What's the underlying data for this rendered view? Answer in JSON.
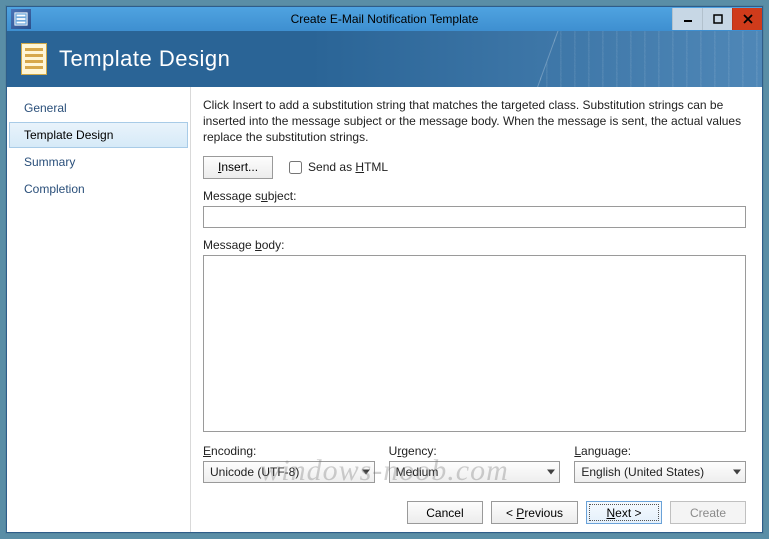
{
  "window": {
    "title": "Create E-Mail Notification Template"
  },
  "banner": {
    "heading": "Template Design"
  },
  "sidebar": {
    "items": [
      {
        "label": "General",
        "active": false
      },
      {
        "label": "Template Design",
        "active": true
      },
      {
        "label": "Summary",
        "active": false
      },
      {
        "label": "Completion",
        "active": false
      }
    ]
  },
  "content": {
    "description": "Click Insert to add a substitution string that matches the targeted class. Substitution strings can be inserted into the message subject or the message body. When the message is sent, the actual values replace the substitution strings.",
    "insert_button": "Insert...",
    "send_html_label": "Send as HTML",
    "send_html_checked": false,
    "subject_label": "Message subject:",
    "subject_value": "",
    "body_label": "Message body:",
    "body_value": "",
    "encoding_label": "Encoding:",
    "encoding_value": "Unicode (UTF-8)",
    "urgency_label": "Urgency:",
    "urgency_value": "Medium",
    "language_label": "Language:",
    "language_value": "English (United States)"
  },
  "footer": {
    "cancel": "Cancel",
    "previous": "< Previous",
    "next": "Next >",
    "create": "Create"
  },
  "watermark": "windows-noob.com"
}
